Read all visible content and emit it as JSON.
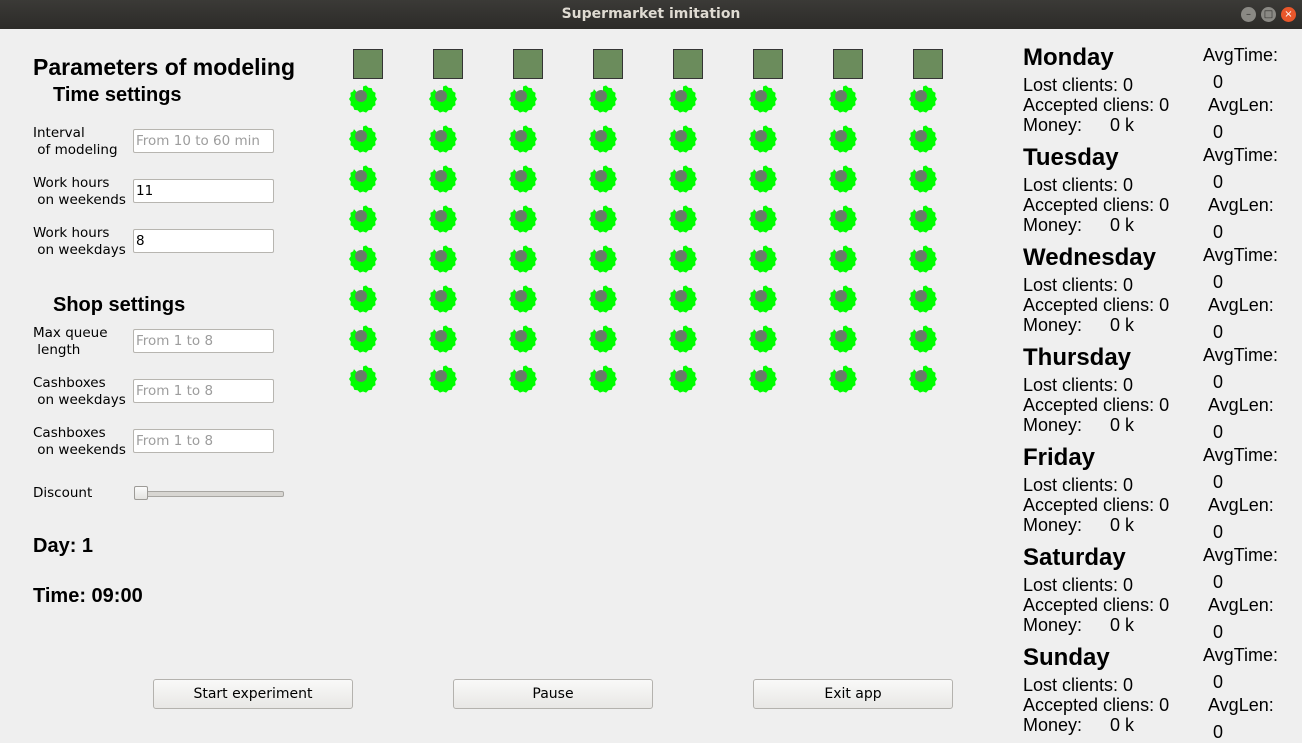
{
  "window": {
    "title": "Supermarket imitation"
  },
  "params": {
    "heading": "Parameters of modeling",
    "time_settings": "Time settings",
    "interval_label": "Interval\n of modeling",
    "interval_placeholder": "From 10 to 60 min",
    "interval_value": "",
    "weekend_hours_label": "Work hours\n on weekends",
    "weekend_hours_value": "11",
    "weekday_hours_label": "Work hours\n on weekdays",
    "weekday_hours_value": "8",
    "shop_settings": "Shop settings",
    "queue_label": "Max queue\n length",
    "queue_placeholder": "From 1 to 8",
    "cash_weekdays_label": "Cashboxes\n on weekdays",
    "cash_weekdays_placeholder": "From 1 to 8",
    "cash_weekends_label": "Cashboxes\n on weekends",
    "cash_weekends_placeholder": "From 1 to 8",
    "discount_label": "Discount",
    "discount_value": 0
  },
  "status": {
    "day": "Day: 1",
    "time": "Time: 09:00"
  },
  "buttons": {
    "start": "Start experiment",
    "pause": "Pause",
    "exit": "Exit app"
  },
  "grid": {
    "cashboxes": 8,
    "queue_rows": 8,
    "cash_color": "#6b8c5c",
    "client_color": "#00ff00",
    "client_center_color": "#6b7b6b"
  },
  "stats_labels": {
    "lost": "Lost clients: 0",
    "accepted": "Accepted cliens: 0",
    "money": "Money:",
    "money_value": "0 k",
    "avg_time": "AvgTime:",
    "avg_time_value": "0",
    "avg_len": "AvgLen:",
    "avg_len_value": "0"
  },
  "days": [
    "Monday",
    "Tuesday",
    "Wednesday",
    "Thursday",
    "Friday",
    "Saturday",
    "Sunday"
  ]
}
